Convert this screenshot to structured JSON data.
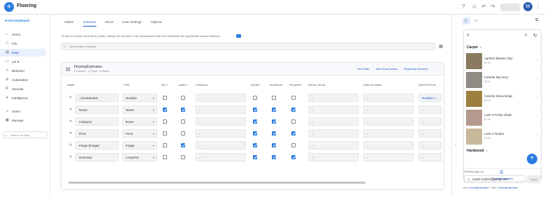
{
  "app": {
    "title": "Flooring",
    "logo_glyph": "✈",
    "avatar": "M",
    "accent": "#2a7de1"
  },
  "sidebar": {
    "status": "Not Deployed",
    "items": [
      {
        "label": "Home",
        "icon": "home-icon",
        "glyph": "⌂",
        "active": false
      },
      {
        "label": "Info",
        "icon": "info-icon",
        "glyph": "ⓘ",
        "active": false
      },
      {
        "label": "Data",
        "icon": "data-icon",
        "glyph": "▤",
        "active": true
      },
      {
        "label": "UX ●",
        "icon": "ux-icon",
        "glyph": "▭",
        "active": false
      },
      {
        "label": "Behavior",
        "icon": "behavior-icon",
        "glyph": "≺",
        "active": false
      },
      {
        "label": "Automation",
        "icon": "automation-icon",
        "glyph": "⚙",
        "active": false
      },
      {
        "label": "Security",
        "icon": "security-icon",
        "glyph": "⛨",
        "active": false
      },
      {
        "label": "Intelligence",
        "icon": "intelligence-icon",
        "glyph": "✦",
        "active": false
      },
      {
        "label": "Users",
        "icon": "users-icon",
        "glyph": "☺",
        "active": false
      },
      {
        "label": "Manage",
        "icon": "manage-icon",
        "glyph": "▦",
        "active": false
      }
    ],
    "search_help": "Search for help"
  },
  "main": {
    "tabs": [
      {
        "label": "Tables"
      },
      {
        "label": "Columns"
      },
      {
        "label": "Slices"
      },
      {
        "label": "User Settings"
      },
      {
        "label": "Options"
      }
    ],
    "active_tab": "Columns",
    "description": "To add or remove columns in a table, change the structure of the spreadsheet and then regenerate the appropriate column structure.",
    "search_placeholder": "Search table columns"
  },
  "table": {
    "name": "FlooringEstimates",
    "meta": "6 columns · 🖉 Rows · ⊘ Name",
    "actions": {
      "view": "View Table",
      "add": "Add Virtual Column",
      "regen": "Regenerate Structure"
    },
    "headers": {
      "name": "NAME",
      "type": "TYPE",
      "key": "KEY?",
      "label": "LABEL?",
      "formula": "FORMULA",
      "show": "SHOW?",
      "editable": "EDITABLE?",
      "require": "REQUIRE?",
      "initial": "INITIAL VALUE",
      "display": "DISPLAY NAME",
      "description": "DESCRIPTION"
    },
    "placeholder": "=",
    "rows": [
      {
        "name": "_RowNumber",
        "type": "Number",
        "key": false,
        "label": false,
        "show": false,
        "editable": false,
        "require": false,
        "description": "Number o"
      },
      {
        "name": "Name",
        "type": "Name",
        "key": true,
        "label": true,
        "show": true,
        "editable": true,
        "require": true,
        "description": "="
      },
      {
        "name": "Category",
        "type": "Enum",
        "key": false,
        "label": false,
        "show": true,
        "editable": true,
        "require": false,
        "description": "="
      },
      {
        "name": "Price",
        "type": "Price",
        "key": false,
        "label": false,
        "show": true,
        "editable": true,
        "require": true,
        "description": "="
      },
      {
        "name": "Image [Image]",
        "type": "Image",
        "key": false,
        "label": true,
        "show": true,
        "editable": true,
        "require": false,
        "description": "="
      },
      {
        "name": "Overview",
        "type": "LongText",
        "key": false,
        "label": false,
        "show": true,
        "editable": true,
        "require": false,
        "description": "="
      }
    ]
  },
  "preview": {
    "sections": [
      {
        "title": "Carpet",
        "count": "6",
        "items": [
          {
            "name": "Ageless Beauty Clay",
            "price": "$1.99",
            "color": "#8a7a5f"
          },
          {
            "name": "Caserta Sky Grey",
            "price": "$6.15",
            "color": "#8f8b84"
          },
          {
            "name": "Caserta Stone Beige",
            "price": "$5.15",
            "color": "#9d7f3e"
          },
          {
            "name": "Lush II Frosty Glade",
            "price": "$2.95",
            "color": "#b39a8c"
          },
          {
            "name": "Lush II Tundra",
            "price": "$2.55",
            "color": "#c9b89a"
          }
        ]
      },
      {
        "title": "Hardwood",
        "count": "5",
        "items": []
      }
    ],
    "nav_label": "FlooringEstimates",
    "preview_as_label": "Preview App as",
    "email": "martin.heller@gmail.com",
    "apply": "Apply",
    "footer": {
      "view_label": "View:",
      "view": "FlooringEstimates",
      "table_label": "Table:",
      "table": "FlooringEstimates"
    }
  }
}
